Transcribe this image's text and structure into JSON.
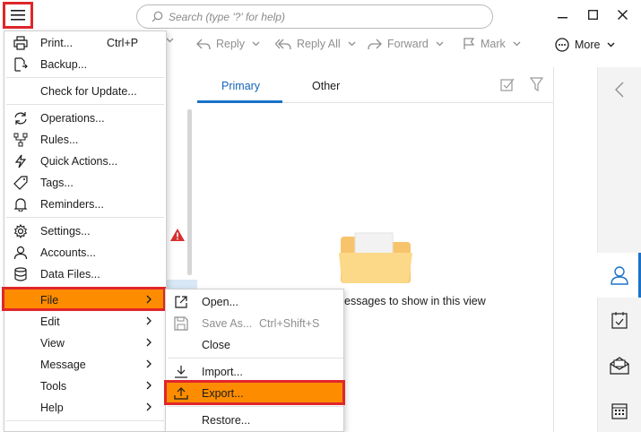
{
  "search": {
    "placeholder": "Search (type '?' for help)"
  },
  "toolbar": {
    "reply": "Reply",
    "reply_all": "Reply All",
    "forward": "Forward",
    "mark": "Mark",
    "more": "More"
  },
  "tabs": {
    "primary": "Primary",
    "other": "Other"
  },
  "empty_view": {
    "message": "essages to show in this view"
  },
  "main_menu": {
    "print": "Print...",
    "print_shortcut": "Ctrl+P",
    "backup": "Backup...",
    "check_update": "Check for Update...",
    "operations": "Operations...",
    "rules": "Rules...",
    "quick_actions": "Quick Actions...",
    "tags": "Tags...",
    "reminders": "Reminders...",
    "settings": "Settings...",
    "accounts": "Accounts...",
    "data_files": "Data Files...",
    "file": "File",
    "edit": "Edit",
    "view": "View",
    "message": "Message",
    "tools": "Tools",
    "help": "Help"
  },
  "file_submenu": {
    "open": "Open...",
    "save_as": "Save As...",
    "save_as_shortcut": "Ctrl+Shift+S",
    "close": "Close",
    "import": "Import...",
    "export": "Export...",
    "restore": "Restore..."
  },
  "colors": {
    "highlight": "#fd8c00",
    "annotation_frame": "#e0262a",
    "accent": "#1a73c9"
  }
}
